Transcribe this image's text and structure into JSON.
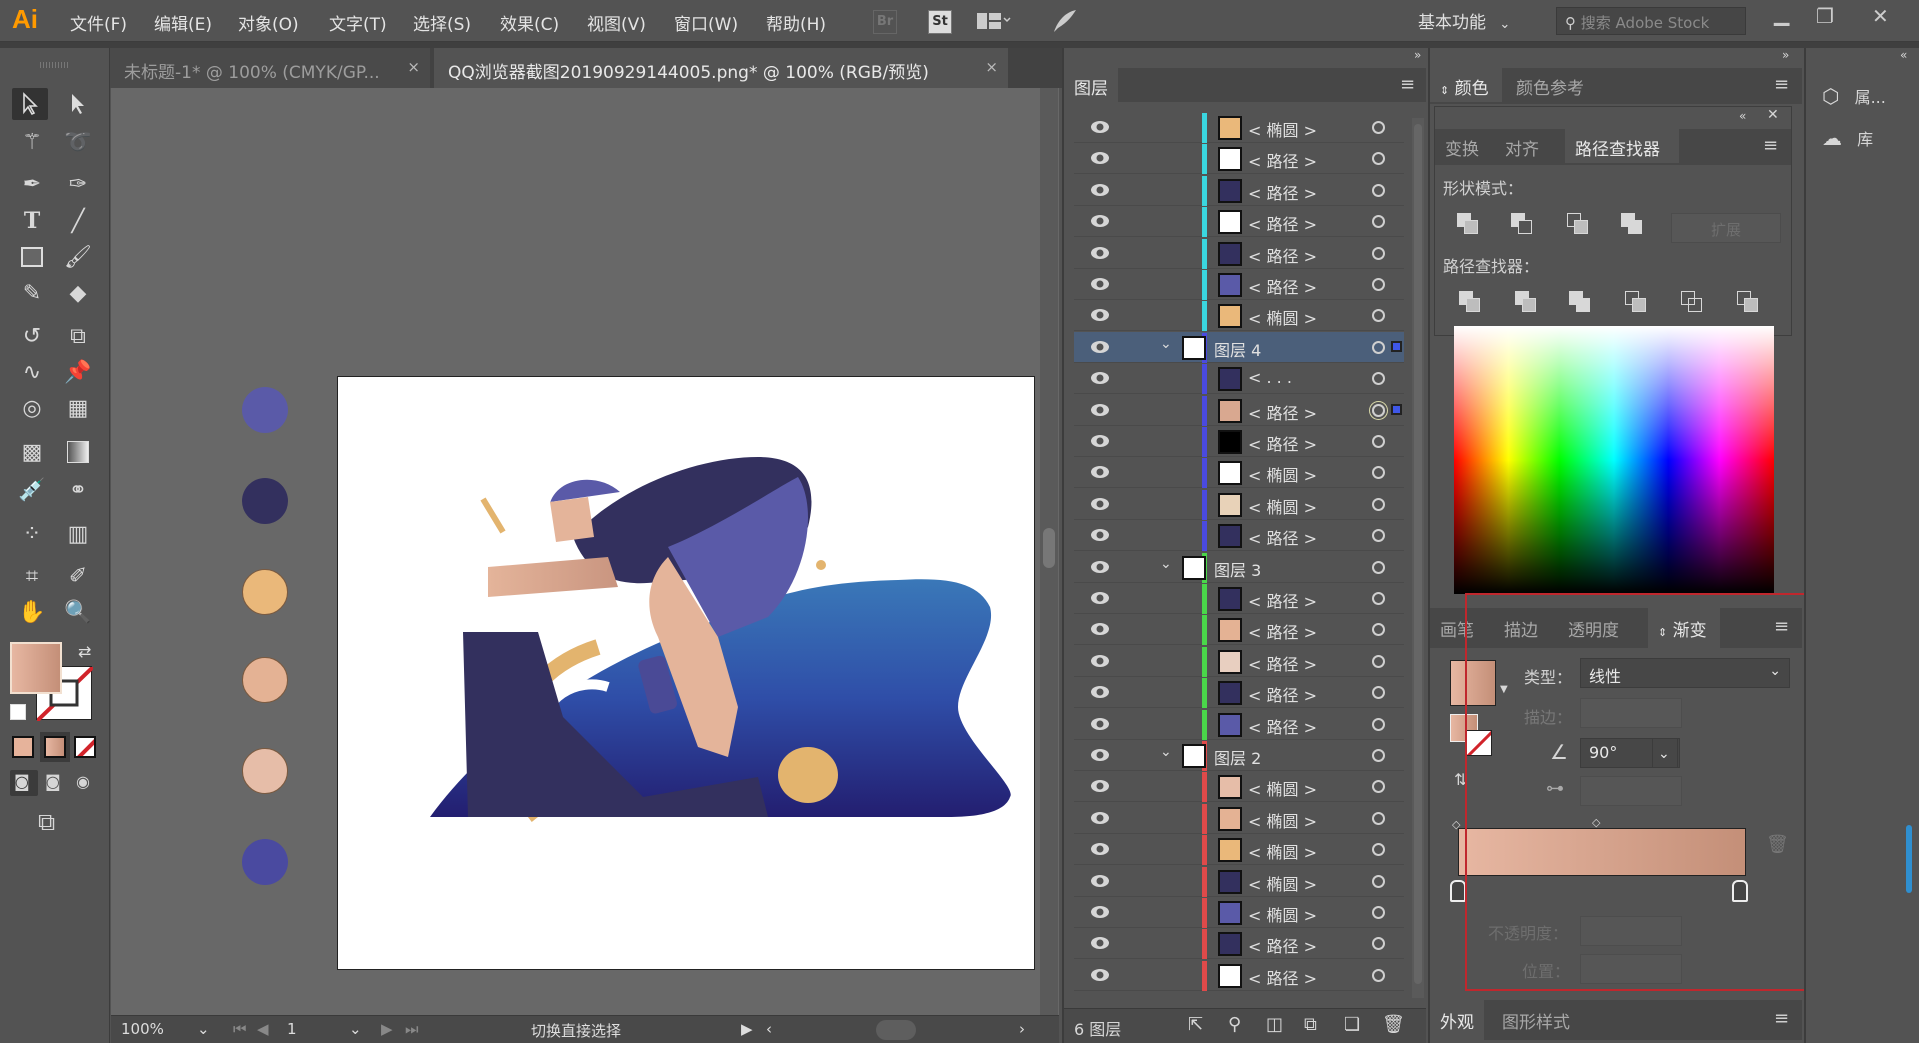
{
  "app": {
    "logo": "Ai",
    "menu": [
      "文件(F)",
      "编辑(E)",
      "对象(O)",
      "文字(T)",
      "选择(S)",
      "效果(C)",
      "视图(V)",
      "窗口(W)",
      "帮助(H)"
    ],
    "top_icons": [
      "Br",
      "St"
    ],
    "workspace": "基本功能",
    "stock_search_placeholder": "搜索 Adobe Stock",
    "window_controls": [
      "minimize",
      "restore",
      "close"
    ]
  },
  "document_tabs": [
    {
      "label": "未标题-1* @ 100% (CMYK/GP...",
      "active": false
    },
    {
      "label": "QQ浏览器截图20190929144005.png* @ 100% (RGB/预览)",
      "active": true
    }
  ],
  "toolbar": {
    "tools": [
      "selection-tool",
      "direct-selection-tool",
      "magic-wand-tool",
      "lasso-tool",
      "pen-tool",
      "curvature-tool",
      "type-tool",
      "line-segment-tool",
      "rectangle-tool",
      "paintbrush-tool",
      "shaper-tool",
      "eraser-tool",
      "rotate-tool",
      "scale-tool",
      "warp-tool",
      "puppet-warp-tool",
      "shape-builder-tool",
      "perspective-grid-tool",
      "mesh-tool",
      "gradient-tool",
      "eyedropper-tool",
      "blend-tool",
      "symbol-sprayer-tool",
      "column-graph-tool",
      "artboard-tool",
      "slice-tool",
      "hand-tool",
      "zoom-tool"
    ],
    "fill_color": "#d9a890",
    "stroke": "none"
  },
  "canvas": {
    "swatch_dots": [
      "#5a5aa8",
      "#33305e",
      "#eab87a",
      "#e4b294",
      "#e6bda8",
      "#4a4aa0"
    ]
  },
  "status_bar": {
    "zoom": "100%",
    "artboard_number": "1",
    "status_text": "切换直接选择"
  },
  "layers_panel": {
    "tab": "图层",
    "rows": [
      {
        "type": "item",
        "name": "< 椭圆 >",
        "color": "#3ad6e0",
        "thumb": "#eab87a"
      },
      {
        "type": "item",
        "name": "< 路径 >",
        "color": "#3ad6e0",
        "thumb": "#ffffff"
      },
      {
        "type": "item",
        "name": "< 路径 >",
        "color": "#3ad6e0",
        "thumb": "#33305e"
      },
      {
        "type": "item",
        "name": "< 路径 >",
        "color": "#3ad6e0",
        "thumb": "#ffffff"
      },
      {
        "type": "item",
        "name": "< 路径 >",
        "color": "#3ad6e0",
        "thumb": "#33305e"
      },
      {
        "type": "item",
        "name": "< 路径 >",
        "color": "#3ad6e0",
        "thumb": "#5a5aa8"
      },
      {
        "type": "item",
        "name": "< 椭圆 >",
        "color": "#3ad6e0",
        "thumb": "#eab87a"
      },
      {
        "type": "layer",
        "name": "图层 4",
        "color": "#4a4ae0",
        "selected": true
      },
      {
        "type": "item",
        "name": "< . . .",
        "color": "#4a4ae0",
        "thumb": "#33305e"
      },
      {
        "type": "item",
        "name": "< 路径 >",
        "color": "#4a4ae0",
        "thumb": "#d9a890",
        "targeted": true
      },
      {
        "type": "item",
        "name": "< 路径 >",
        "color": "#4a4ae0",
        "thumb": "#000000"
      },
      {
        "type": "item",
        "name": "< 椭圆 >",
        "color": "#4a4ae0",
        "thumb": "#ffffff"
      },
      {
        "type": "item",
        "name": "< 椭圆 >",
        "color": "#4a4ae0",
        "thumb": "#e8d2b8"
      },
      {
        "type": "item",
        "name": "< 路径 >",
        "color": "#4a4ae0",
        "thumb": "#33305e"
      },
      {
        "type": "layer",
        "name": "图层 3",
        "color": "#4ad64a"
      },
      {
        "type": "item",
        "name": "< 路径 >",
        "color": "#4ad64a",
        "thumb": "#33305e"
      },
      {
        "type": "item",
        "name": "< 路径 >",
        "color": "#4ad64a",
        "thumb": "#e4b294"
      },
      {
        "type": "item",
        "name": "< 路径 >",
        "color": "#4ad64a",
        "thumb": "#e8cfc0"
      },
      {
        "type": "item",
        "name": "< 路径 >",
        "color": "#4ad64a",
        "thumb": "#33305e"
      },
      {
        "type": "item",
        "name": "< 路径 >",
        "color": "#4ad64a",
        "thumb": "#5a5aa8"
      },
      {
        "type": "layer",
        "name": "图层 2",
        "color": "#e04a4a"
      },
      {
        "type": "item",
        "name": "< 椭圆 >",
        "color": "#e04a4a",
        "thumb": "#e6bda8"
      },
      {
        "type": "item",
        "name": "< 椭圆 >",
        "color": "#e04a4a",
        "thumb": "#e4b294"
      },
      {
        "type": "item",
        "name": "< 椭圆 >",
        "color": "#e04a4a",
        "thumb": "#eab87a"
      },
      {
        "type": "item",
        "name": "< 椭圆 >",
        "color": "#e04a4a",
        "thumb": "#33305e"
      },
      {
        "type": "item",
        "name": "< 椭圆 >",
        "color": "#e04a4a",
        "thumb": "#5a5aa8"
      },
      {
        "type": "item",
        "name": "< 路径 >",
        "color": "#e04a4a",
        "thumb": "#33305e"
      },
      {
        "type": "item",
        "name": "< 路径 >",
        "color": "#e04a4a",
        "thumb": "#ffffff"
      }
    ],
    "footer_count": "6 图层"
  },
  "color_panel": {
    "tabs": [
      "颜色",
      "颜色参考"
    ]
  },
  "pathfinder_panel": {
    "tabs": [
      "变换",
      "对齐",
      "路径查找器"
    ],
    "shape_modes_label": "形状模式：",
    "expand_button": "扩展",
    "pathfinders_label": "路径查找器："
  },
  "gradient_panel": {
    "tabs": [
      "画笔",
      "描边",
      "透明度",
      "渐变"
    ],
    "type_label": "类型：",
    "type_value": "线性",
    "stroke_label": "描边：",
    "angle_value": "90°",
    "opacity_label": "不透明度：",
    "location_label": "位置：",
    "start_color": "#e7b7a2",
    "end_color": "#c48f78"
  },
  "appearance_panel": {
    "tabs": [
      "外观",
      "图形样式"
    ]
  },
  "dock": {
    "items": [
      "属...",
      "库"
    ]
  }
}
